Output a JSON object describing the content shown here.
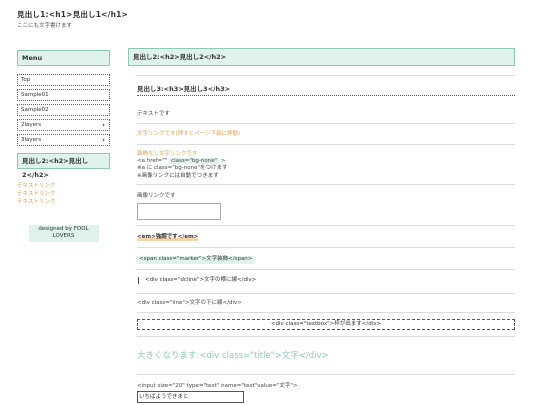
{
  "header": {
    "title": "見出し1:<h1>見出し1</h1>",
    "description": "ここにも文字書けます"
  },
  "sidebar": {
    "menu_heading": "Menu",
    "menu_items": [
      {
        "label": "Top",
        "has_arrow": false
      },
      {
        "label": "Sample01",
        "has_arrow": false
      },
      {
        "label": "Sample02",
        "has_arrow": false
      },
      {
        "label": "2layers",
        "has_arrow": true
      },
      {
        "label": "3layers",
        "has_arrow": true
      }
    ],
    "arrow_glyph": "›",
    "h2_heading": "見出し2:<h2>見出し2</h2>",
    "links": [
      "テキストリンク",
      "テキストリンク",
      "テキストリンク"
    ],
    "credit": "designed by FOOL LOVERS"
  },
  "main": {
    "h2": "見出し2:<h2>見出し2</h2>",
    "h3": "見出し3:<h3>見出し3</h3>",
    "text": "テキストです",
    "link_text": "文字リンクです(押すとページ下部に移動)",
    "no_decoration_link": "装飾なし文字リンクです",
    "code_a_prefix": "<a  href=\"\" ",
    "code_a_class": "class=\"bg-none\"",
    "code_a_suffix": ">",
    "note1": "※a に class=\"bg-none\"をつけます",
    "note2": "※画像リンクには自動でつきます",
    "image_link_label": "画像リンクです",
    "em_text": "<em>強調です</em>",
    "marker_text": "<span class=\"marker\">文字装飾</span>",
    "dcline_text": "<div class=\"dcline\">文字の横に線</div>",
    "line_text": "<div class=\"line\">文字の下に線</div>",
    "textbox_text": "<div class=\"textbox\">枠が出ます</div>",
    "title_text": "大きくなります:<div class=\"title\">文字</div>",
    "input_code": "<input size=\"20\" type=\"text\" name=\"text\"value=\"文字\">",
    "input_value": "いちばようできまと"
  },
  "colors": {
    "accent_mint": "#dff3ec",
    "accent_border": "#8cc9b6",
    "link_orange": "#e0a050"
  }
}
